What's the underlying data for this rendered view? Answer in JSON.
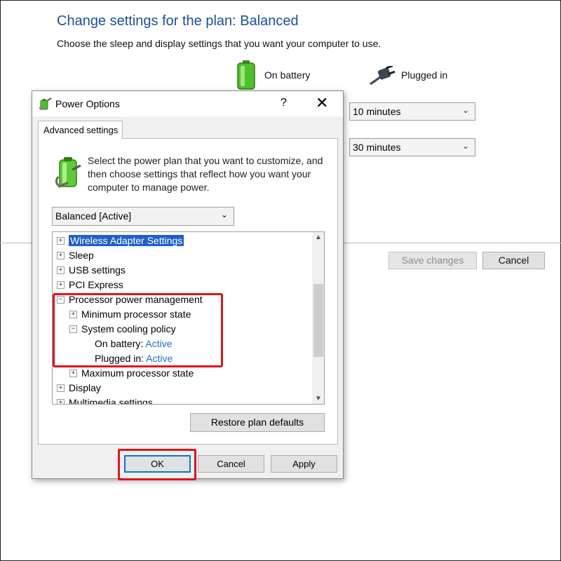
{
  "background": {
    "title": "Change settings for the plan: Balanced",
    "subtitle": "Choose the sleep and display settings that you want your computer to use.",
    "on_battery_label": "On battery",
    "plugged_in_label": "Plugged in",
    "plugged_select_1": "10 minutes",
    "plugged_select_2": "30 minutes",
    "save_changes": "Save changes",
    "cancel": "Cancel"
  },
  "dialog": {
    "title": "Power Options",
    "help": "?",
    "close": "✕",
    "tab": "Advanced settings",
    "description": "Select the power plan that you want to customize, and then choose settings that reflect how you want your computer to manage power.",
    "plan_select": "Balanced [Active]",
    "tree": {
      "wireless": "Wireless Adapter Settings",
      "sleep": "Sleep",
      "usb": "USB settings",
      "pci": "PCI Express",
      "processor": "Processor power management",
      "min_state": "Minimum processor state",
      "cooling": "System cooling policy",
      "on_battery_label": "On battery:",
      "on_battery_value": "Active",
      "plugged_label": "Plugged in:",
      "plugged_value": "Active",
      "max_state": "Maximum processor state",
      "display": "Display",
      "multimedia": "Multimedia settings"
    },
    "restore": "Restore plan defaults",
    "ok": "OK",
    "cancel": "Cancel",
    "apply": "Apply"
  },
  "icons": {
    "battery": "battery-icon",
    "plug": "plug-icon",
    "power_options": "power-options-icon",
    "power_plan": "power-plan-icon"
  },
  "colors": {
    "title_blue": "#1e4fa3",
    "selection": "#1e5fc9",
    "value_link": "#1e6fd0",
    "highlight_red": "#e2141e"
  }
}
